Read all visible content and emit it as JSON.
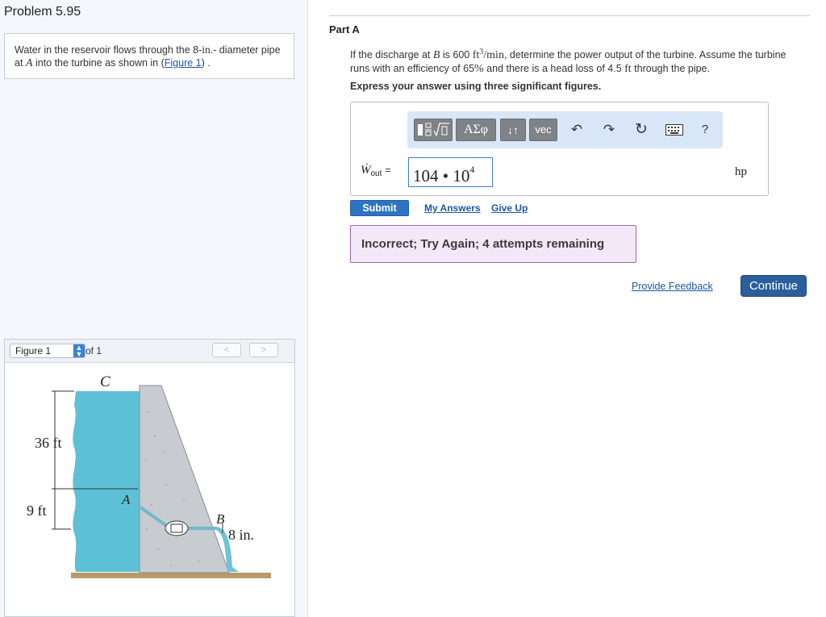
{
  "problem": {
    "title": "Problem 5.95",
    "statement": {
      "text1": "Water in the reservoir flows through the 8-",
      "unit_in": "in.",
      "text2": "- diameter pipe at ",
      "var_A": "A",
      "text3": " into the turbine as shown in (",
      "figure_link": "Figure 1",
      "text4": ") ."
    }
  },
  "figure_panel": {
    "select_value": "Figure 1",
    "of_text": "of 1",
    "prev_label": "<",
    "next_label": ">",
    "labels": {
      "C": "C",
      "A": "A",
      "B": "B",
      "height_36": "36 ft",
      "height_9": "9 ft",
      "diameter": "8 in."
    },
    "colors": {
      "water": "#5cc0d6",
      "dam": "#c8cbcf",
      "ground": "#b89a68",
      "pipe": "#6fb9c9"
    }
  },
  "part": {
    "label": "Part A",
    "question": {
      "p1": "If the discharge at ",
      "var_B": "B",
      "p2": " is 600 ",
      "unit_ft": "ft",
      "exp3": "3",
      "unit_min": "/min",
      "p3": ", determine the power output of the turbine. Assume the turbine runs with an efficiency of 65",
      "pct": "%",
      "p4": " and there is a head loss of 4.5 ",
      "unit_ft2": "ft",
      "p5": " through the pipe."
    },
    "instruction": "Express your answer using three significant figures."
  },
  "answer": {
    "toolbar": {
      "templates_icon": "fraction-sqrt-template-icon",
      "greek_label": "ΑΣφ",
      "arrows_label": "↓↑",
      "vec_label": "vec",
      "undo_icon": "↶",
      "redo_icon": "↷",
      "reset_icon": "↻",
      "keyboard_icon": "keyboard-icon",
      "help_label": "?"
    },
    "variable": {
      "symbol": "Ẇ",
      "subscript": "out",
      "equals": "="
    },
    "input": {
      "mantissa": "104 • 10",
      "exponent": "4"
    },
    "unit": "hp"
  },
  "actions": {
    "submit_label": "Submit",
    "my_answers_label": "My Answers",
    "give_up_label": "Give Up"
  },
  "feedback": {
    "message": "Incorrect; Try Again; 4 attempts remaining",
    "provide_feedback_label": "Provide Feedback",
    "continue_label": "Continue"
  },
  "colors": {
    "accent": "#2d74c4",
    "continue": "#2a5f9c",
    "link": "#1a57a8",
    "feedback_bg": "#f3e8f8",
    "feedback_border": "#a064b5",
    "toolbar_bg": "#d9e6f7"
  }
}
